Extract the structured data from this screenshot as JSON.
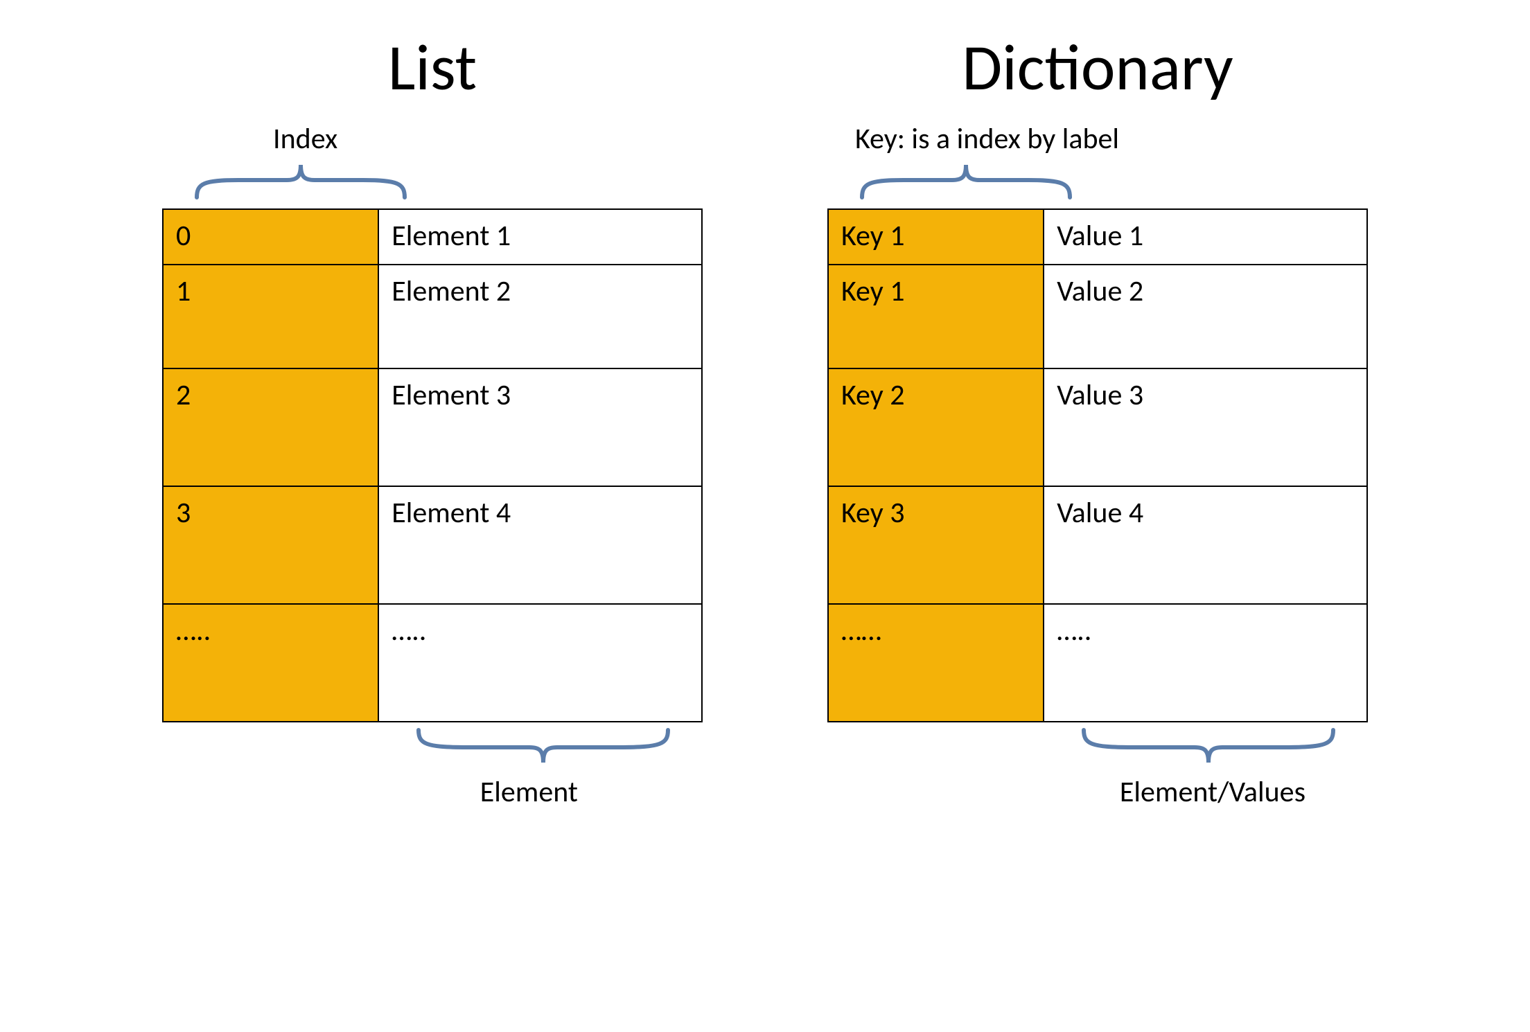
{
  "list": {
    "title": "List",
    "top_label": "Index",
    "bottom_label": "Element",
    "rows": [
      {
        "index": "0",
        "element": "Element  1"
      },
      {
        "index": "1",
        "element": "Element  2"
      },
      {
        "index": "2",
        "element": "Element  3"
      },
      {
        "index": "3",
        "element": "Element  4"
      },
      {
        "index": "…..",
        "element": "….."
      }
    ]
  },
  "dictionary": {
    "title": "Dictionary",
    "top_label": "Key: is a index by label",
    "bottom_label": "Element/Values",
    "rows": [
      {
        "key": "Key 1",
        "value": "Value  1"
      },
      {
        "key": "Key 1",
        "value": "Value  2"
      },
      {
        "key": "Key 2",
        "value": "Value 3"
      },
      {
        "key": "Key 3",
        "value": "Value  4"
      },
      {
        "key": "……",
        "value": "….."
      }
    ]
  },
  "colors": {
    "highlight": "#f4b208",
    "brace": "#5b7daa"
  }
}
